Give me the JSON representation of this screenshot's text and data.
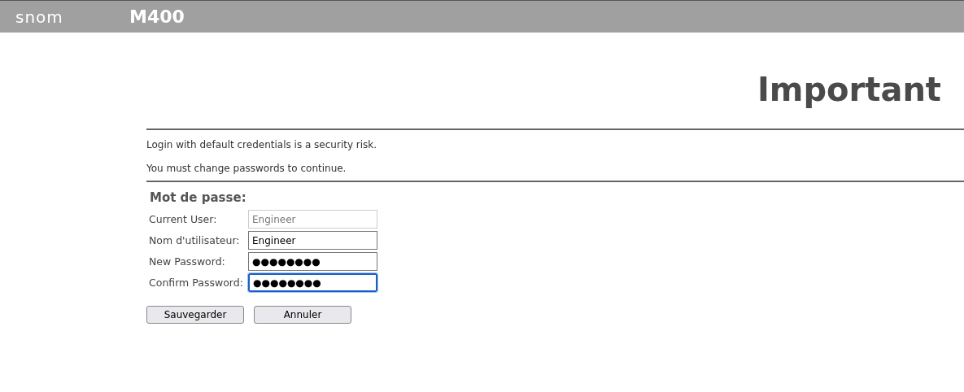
{
  "header": {
    "brand": "snom",
    "model": "M400"
  },
  "title": "Important",
  "messages": [
    "Login with default credentials is a security risk.",
    "You must change passwords to continue."
  ],
  "section_title": "Mot de passe:",
  "fields": [
    {
      "label": "Current User:",
      "value": "Engineer",
      "disabled": true,
      "focused": false
    },
    {
      "label": "Nom d'utilisateur:",
      "value": "Engineer",
      "disabled": false,
      "focused": false
    },
    {
      "label": "New Password:",
      "value": "●●●●●●●●",
      "disabled": false,
      "focused": false
    },
    {
      "label": "Confirm Password:",
      "value": "●●●●●●●●",
      "disabled": false,
      "focused": true
    }
  ],
  "buttons": [
    "Sauvegarder",
    "Annuler"
  ]
}
